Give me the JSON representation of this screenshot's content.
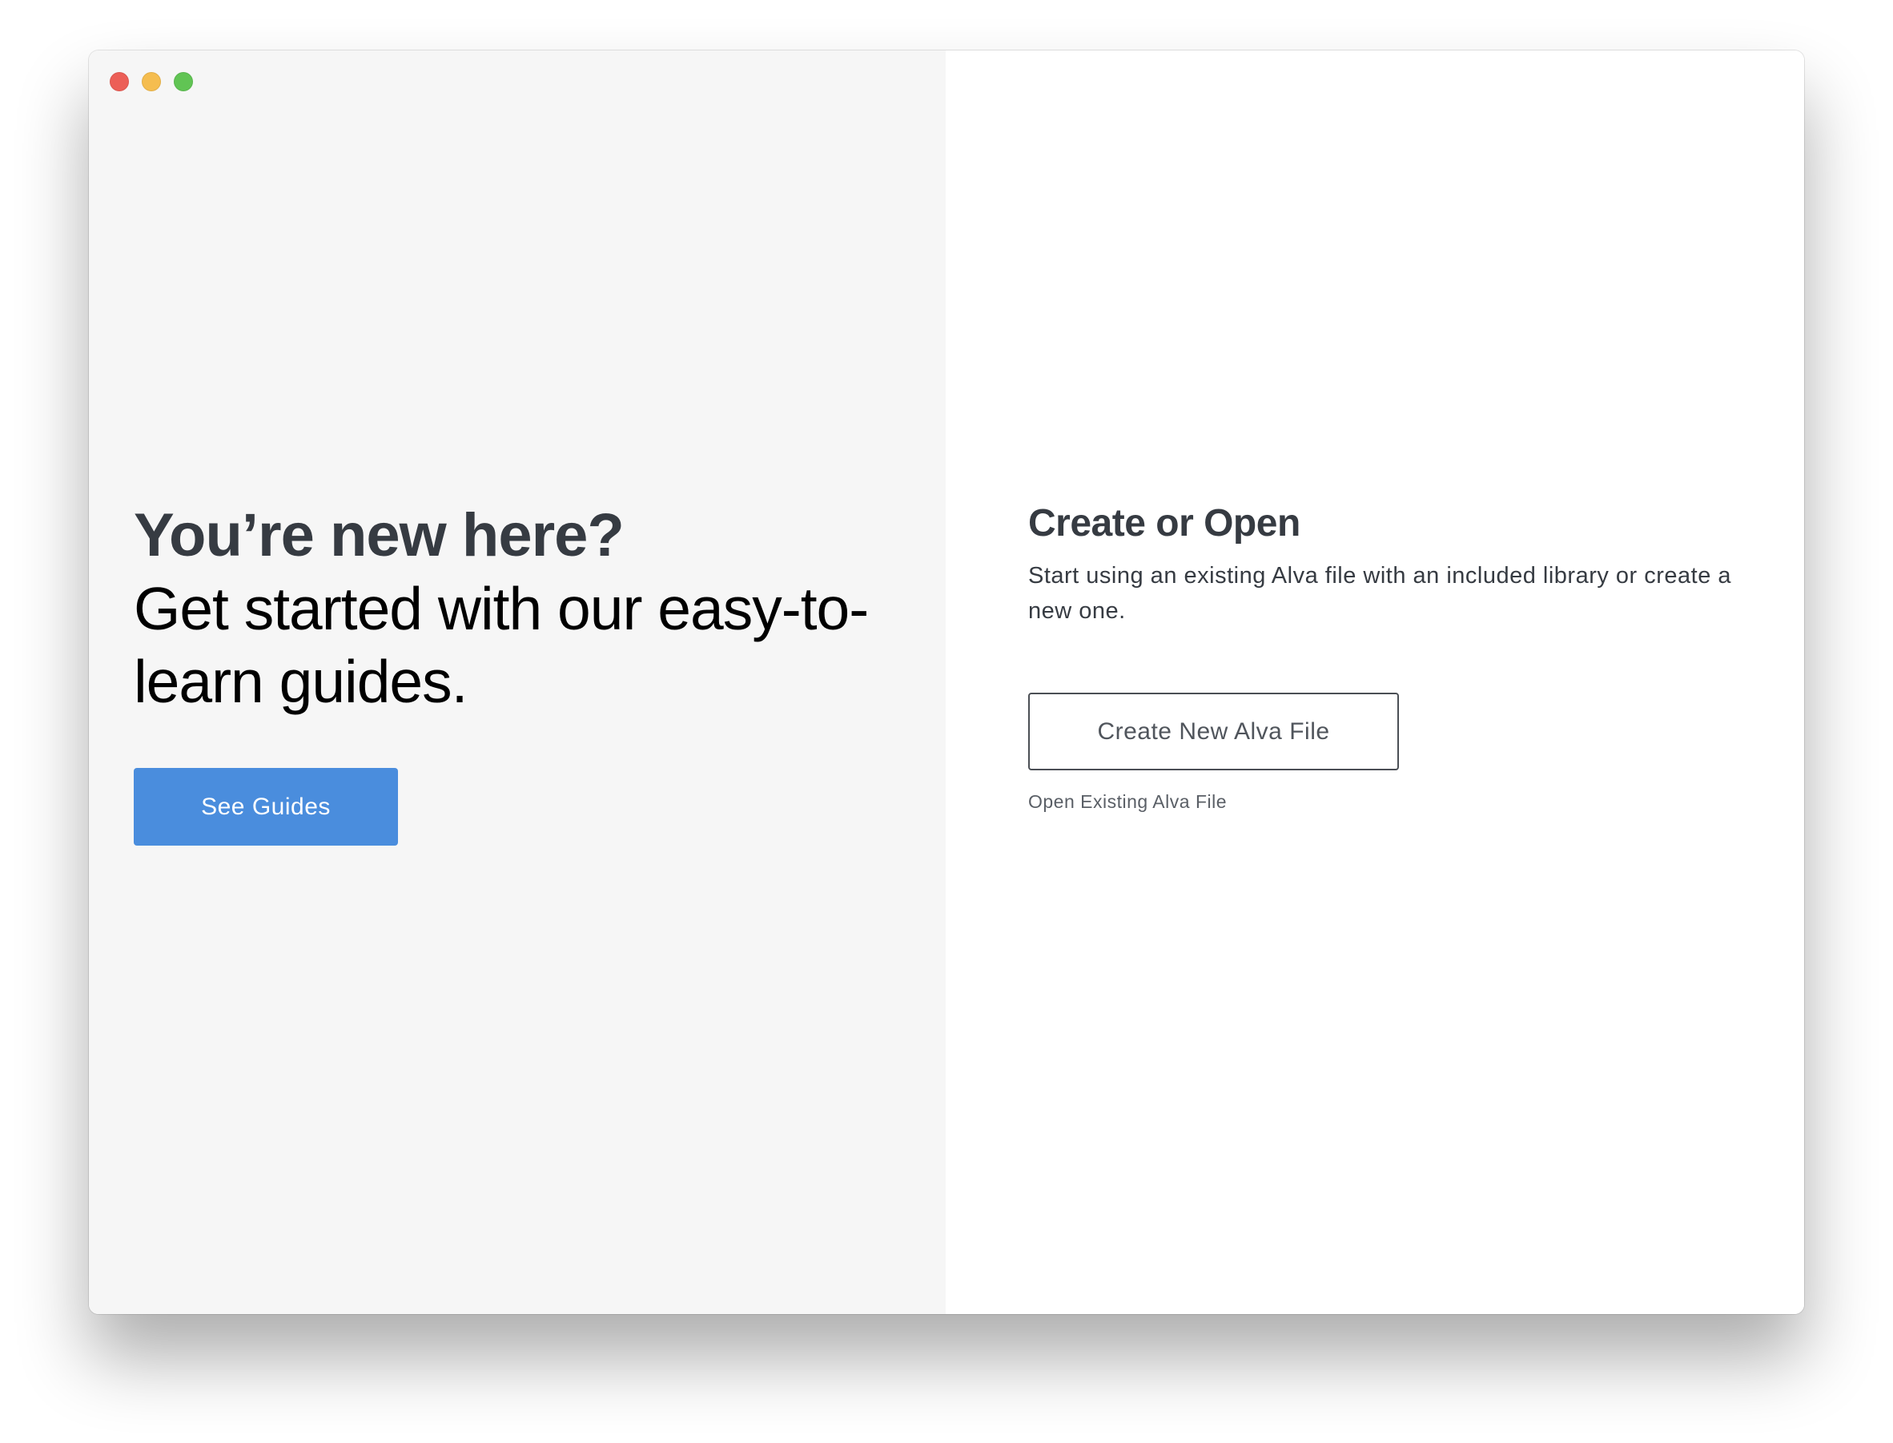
{
  "window": {
    "controls": [
      {
        "name": "close",
        "color": "#ec5f57"
      },
      {
        "name": "minimize",
        "color": "#f5bd4f"
      },
      {
        "name": "zoom",
        "color": "#61c454"
      }
    ]
  },
  "left": {
    "title": "You’re new here?",
    "subtitle": "Get started with our easy-to-learn guides.",
    "button_label": "See Guides",
    "button_color": "#4a8ddd",
    "background_color": "#f6f6f6"
  },
  "right": {
    "title": "Create or Open",
    "description": "Start using an existing Alva file with an included library or create a new one.",
    "create_button_label": "Create New Alva File",
    "open_link_label": "Open Existing Alva File"
  }
}
